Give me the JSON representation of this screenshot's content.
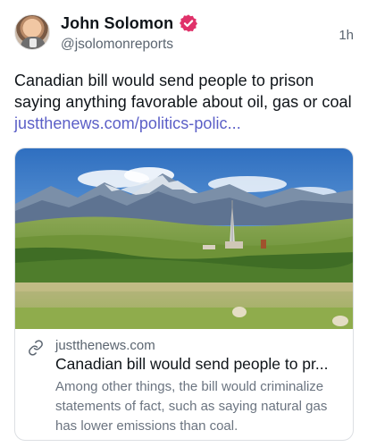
{
  "author": {
    "display_name": "John Solomon",
    "handle": "@jsolomonreports",
    "verified": true
  },
  "timestamp": "1h",
  "post": {
    "text": "Canadian bill would send people to prison saying anything favorable about oil, gas or coal",
    "link_text": "justthenews.com/politics-polic..."
  },
  "link_card": {
    "domain": "justthenews.com",
    "title": "Canadian bill would send people to pr...",
    "description": "Among other things, the bill would criminalize statements of fact, such as saying natural gas has lower emissions than coal."
  },
  "colors": {
    "text": "#0f1419",
    "secondary_text": "#5b6570",
    "link": "#5b5fc7",
    "verified_badge": "#e0326a",
    "card_border": "#dcdfe3"
  },
  "icons": {
    "verified": "verified-badge-icon",
    "link": "link-icon"
  }
}
